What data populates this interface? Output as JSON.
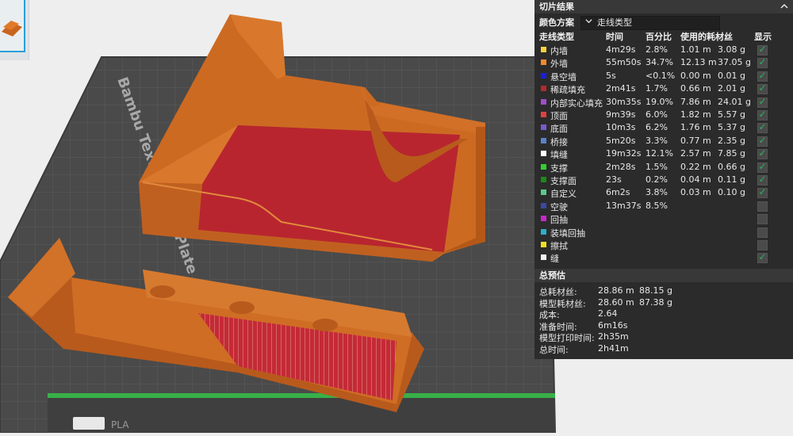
{
  "viewport": {
    "plate_label": "Bambu Textured PEI Plate",
    "plate_logo": "PLA"
  },
  "panel": {
    "title": "切片结果",
    "collapse_icon": "chevron-up-icon",
    "color_scheme_label": "颜色方案",
    "color_scheme_value": "走线类型",
    "columns": {
      "type": "走线类型",
      "time": "时间",
      "percent": "百分比",
      "usage": "使用的耗材丝",
      "display": "显示"
    },
    "rows": [
      {
        "name": "内墙",
        "color": "#f7d33a",
        "time": "4m29s",
        "percent": "2.8%",
        "length": "1.01 m",
        "weight": "3.08 g",
        "shown": true
      },
      {
        "name": "外墙",
        "color": "#f28a2a",
        "time": "55m50s",
        "percent": "34.7%",
        "length": "12.13 m",
        "weight": "37.05 g",
        "shown": true
      },
      {
        "name": "悬空墙",
        "color": "#1c1ce0",
        "time": "5s",
        "percent": "<0.1%",
        "length": "0.00 m",
        "weight": "0.01 g",
        "shown": true
      },
      {
        "name": "稀疏填充",
        "color": "#b02a2a",
        "time": "2m41s",
        "percent": "1.7%",
        "length": "0.66 m",
        "weight": "2.01 g",
        "shown": true
      },
      {
        "name": "内部实心填充",
        "color": "#a04dc8",
        "time": "30m35s",
        "percent": "19.0%",
        "length": "7.86 m",
        "weight": "24.01 g",
        "shown": true
      },
      {
        "name": "顶面",
        "color": "#e04040",
        "time": "9m39s",
        "percent": "6.0%",
        "length": "1.82 m",
        "weight": "5.57 g",
        "shown": true
      },
      {
        "name": "底面",
        "color": "#7a5ad0",
        "time": "10m3s",
        "percent": "6.2%",
        "length": "1.76 m",
        "weight": "5.37 g",
        "shown": true
      },
      {
        "name": "桥接",
        "color": "#5a82c8",
        "time": "5m20s",
        "percent": "3.3%",
        "length": "0.77 m",
        "weight": "2.35 g",
        "shown": true
      },
      {
        "name": "填缝",
        "color": "#ffffff",
        "time": "19m32s",
        "percent": "12.1%",
        "length": "2.57 m",
        "weight": "7.85 g",
        "shown": true
      },
      {
        "name": "支撑",
        "color": "#2fd12f",
        "time": "2m28s",
        "percent": "1.5%",
        "length": "0.22 m",
        "weight": "0.66 g",
        "shown": true
      },
      {
        "name": "支撑面",
        "color": "#1a8a1a",
        "time": "23s",
        "percent": "0.2%",
        "length": "0.04 m",
        "weight": "0.11 g",
        "shown": true
      },
      {
        "name": "自定义",
        "color": "#5ac88a",
        "time": "6m2s",
        "percent": "3.8%",
        "length": "0.03 m",
        "weight": "0.10 g",
        "shown": true
      },
      {
        "name": "空驶",
        "color": "#3a4aa0",
        "time": "13m37s",
        "percent": "8.5%",
        "length": "",
        "weight": "",
        "shown": false
      },
      {
        "name": "回抽",
        "color": "#c828c8",
        "time": "",
        "percent": "",
        "length": "",
        "weight": "",
        "shown": false
      },
      {
        "name": "装填回抽",
        "color": "#2ab0c8",
        "time": "",
        "percent": "",
        "length": "",
        "weight": "",
        "shown": false
      },
      {
        "name": "擦拭",
        "color": "#f0e020",
        "time": "",
        "percent": "",
        "length": "",
        "weight": "",
        "shown": false
      },
      {
        "name": "缝",
        "color": "#f0f0f0",
        "time": "",
        "percent": "",
        "length": "",
        "weight": "",
        "shown": true
      }
    ],
    "summary_title": "总预估",
    "summary": [
      {
        "label": "总耗材丝:",
        "v1": "28.86 m",
        "v2": "88.15 g"
      },
      {
        "label": "模型耗材丝:",
        "v1": "28.60 m",
        "v2": "87.38 g"
      },
      {
        "label": "成本:",
        "v1": "2.64",
        "v2": ""
      },
      {
        "label": "准备时间:",
        "v1": "6m16s",
        "v2": ""
      },
      {
        "label": "模型打印时间:",
        "v1": "2h35m",
        "v2": ""
      },
      {
        "label": "总时间:",
        "v1": "2h41m",
        "v2": ""
      }
    ]
  }
}
